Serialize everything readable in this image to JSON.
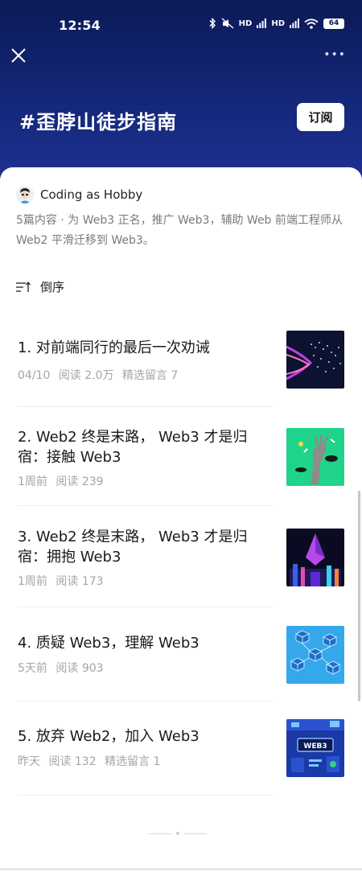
{
  "status_bar": {
    "time": "12:54",
    "battery": "64",
    "signal_1": "HD",
    "signal_2": "HD"
  },
  "header": {
    "topic_title": "#歪脖山徒步指南",
    "subscribe_label": "订阅",
    "more_label": "•••"
  },
  "author": {
    "name": "Coding as Hobby"
  },
  "description": "5篇内容 · 为 Web3 正名，推广 Web3，辅助 Web 前端工程师从 Web2 平滑迁移到 Web3。",
  "sort": {
    "label": "倒序"
  },
  "articles": [
    {
      "title": "1. 对前端同行的最后一次劝诫",
      "date": "04/10",
      "reads": "阅读 2.0万",
      "comments": "精选留言 7"
    },
    {
      "title": "2. Web2 终是末路， Web3 才是归宿：接触 Web3",
      "date": "1周前",
      "reads": "阅读 239",
      "comments": ""
    },
    {
      "title": "3. Web2 终是末路， Web3 才是归宿：拥抱 Web3",
      "date": "1周前",
      "reads": "阅读 173",
      "comments": ""
    },
    {
      "title": "4. 质疑 Web3，理解 Web3",
      "date": "5天前",
      "reads": "阅读 903",
      "comments": ""
    },
    {
      "title": "5. 放弃 Web2，加入 Web3",
      "date": "昨天",
      "reads": "阅读 132",
      "comments": "精选留言 1"
    }
  ],
  "thumb_5_text": "WEB3",
  "colors": {
    "header_top": "#0b1a57",
    "header_bottom": "#1e3291",
    "meta_gray": "#a5a5a5",
    "thumb_green": "#1fd48a"
  }
}
